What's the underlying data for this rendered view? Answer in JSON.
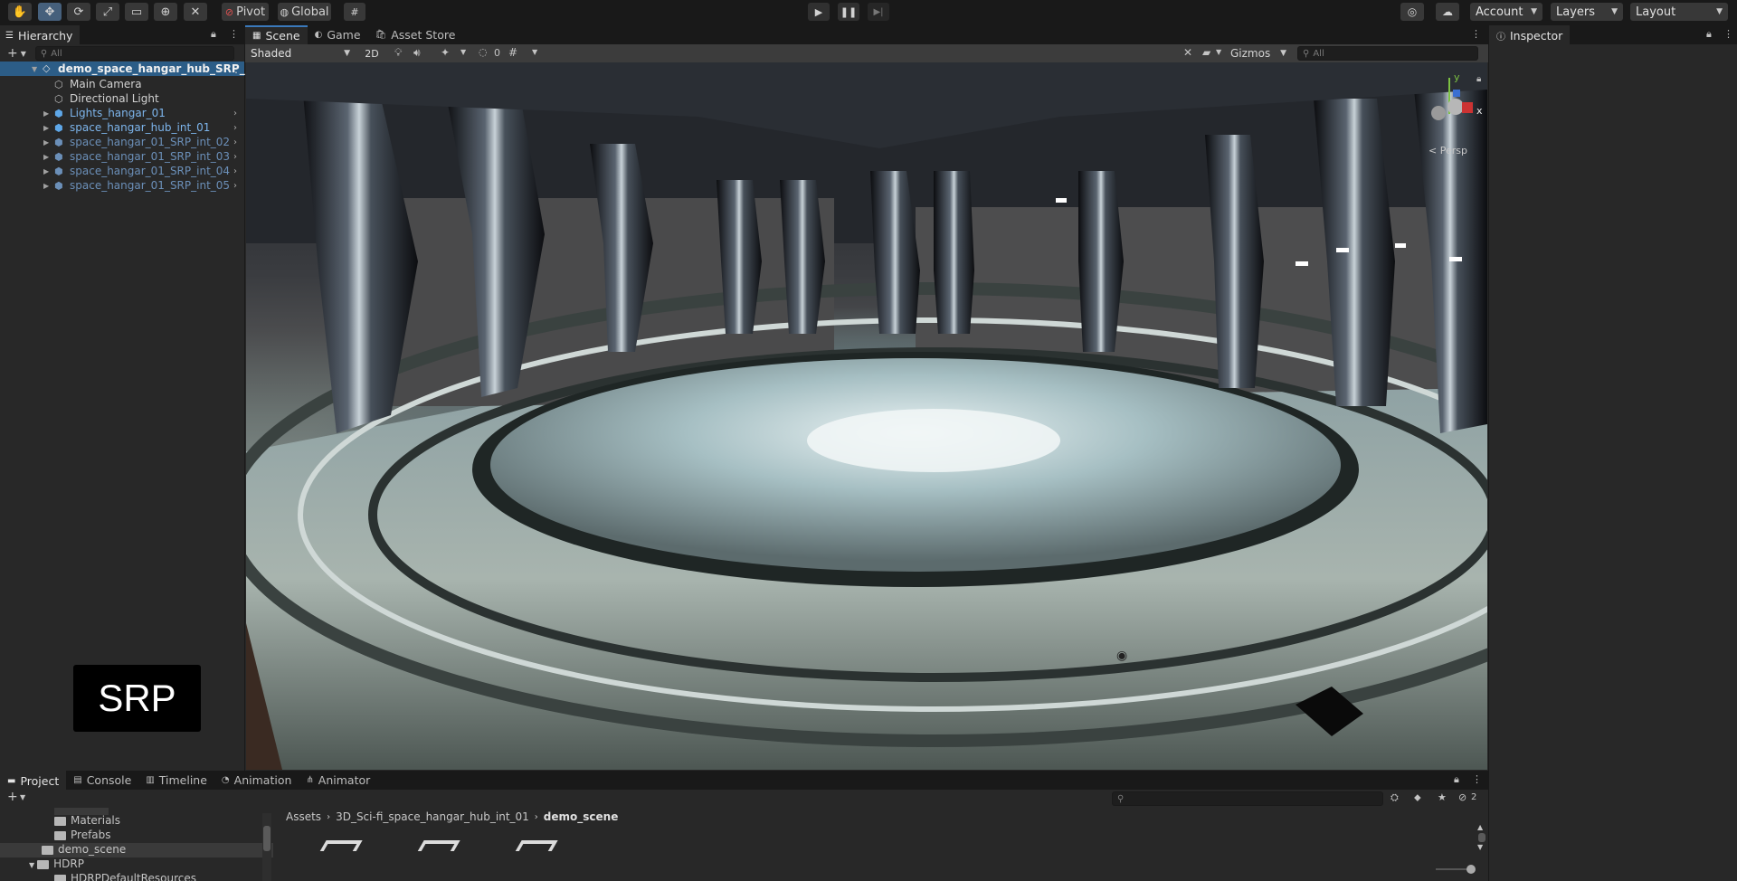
{
  "toolbar": {
    "pivot_label": "Pivot",
    "global_label": "Global",
    "account_label": "Account",
    "layers_label": "Layers",
    "layout_label": "Layout"
  },
  "hierarchy": {
    "tab_label": "Hierarchy",
    "search_placeholder": "All",
    "root": "demo_space_hangar_hub_SRP_",
    "items": [
      {
        "label": "Main Camera"
      },
      {
        "label": "Directional Light"
      },
      {
        "label": "Lights_hangar_01"
      },
      {
        "label": "space_hangar_hub_int_01"
      },
      {
        "label": "space_hangar_01_SRP_int_02"
      },
      {
        "label": "space_hangar_01_SRP_int_03"
      },
      {
        "label": "space_hangar_01_SRP_int_04"
      },
      {
        "label": "space_hangar_01_SRP_int_05"
      }
    ],
    "badge": "SRP"
  },
  "scene_tabs": {
    "scene": "Scene",
    "game": "Game",
    "asset_store": "Asset Store"
  },
  "scene_toolbar": {
    "shading": "Shaded",
    "mode_2d": "2D",
    "hidden_count": "0",
    "gizmos": "Gizmos",
    "search_placeholder": "All"
  },
  "gizmo": {
    "y": "y",
    "x": "x",
    "persp": "< Persp"
  },
  "inspector": {
    "tab_label": "Inspector"
  },
  "bottom_tabs": {
    "project": "Project",
    "console": "Console",
    "timeline": "Timeline",
    "animation": "Animation",
    "animator": "Animator"
  },
  "project": {
    "hidden_count": "2",
    "tree": [
      {
        "label": "Materials"
      },
      {
        "label": "Prefabs"
      },
      {
        "label": "demo_scene"
      },
      {
        "label": "HDRP"
      },
      {
        "label": "HDRPDefaultResources"
      }
    ],
    "breadcrumb": [
      "Assets",
      "3D_Sci-fi_space_hangar_hub_int_01",
      "demo_scene"
    ]
  }
}
